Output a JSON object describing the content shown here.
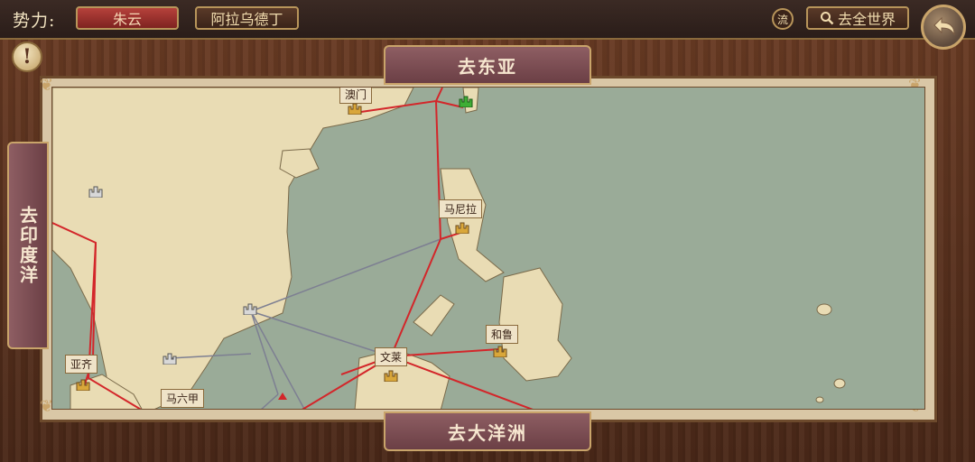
{
  "header": {
    "faction_label": "势力:",
    "faction_name": "朱云",
    "leader_name": "阿拉乌德丁",
    "flow_label": "流",
    "world_button_label": "去全世界"
  },
  "nav": {
    "east_asia": "去东亚",
    "india_ocean": "去印度洋",
    "oceania": "去大洋洲"
  },
  "cities": [
    {
      "name": "澳门",
      "owner": "gold"
    },
    {
      "name": "马尼拉",
      "owner": "gold"
    },
    {
      "name": "和鲁",
      "owner": "gold"
    },
    {
      "name": "文莱",
      "owner": "gold"
    },
    {
      "name": "亚齐",
      "owner": "gold"
    },
    {
      "name": "马六甲",
      "owner": "gold"
    }
  ],
  "unlabeled_cities": [
    "green",
    "white",
    "white",
    "white"
  ],
  "icons": {
    "alert": "exclamation-icon",
    "search": "search-icon",
    "back": "back-arrow-icon"
  },
  "colors": {
    "sea": "#9aab98",
    "land": "#e9dcb4",
    "route_active": "#d3262a",
    "route_inactive": "#7d7f92",
    "faction_red": "#b6413b",
    "gold_city": "#d9a73a",
    "green_city": "#3fae35",
    "white_city": "#d8d8d8"
  }
}
